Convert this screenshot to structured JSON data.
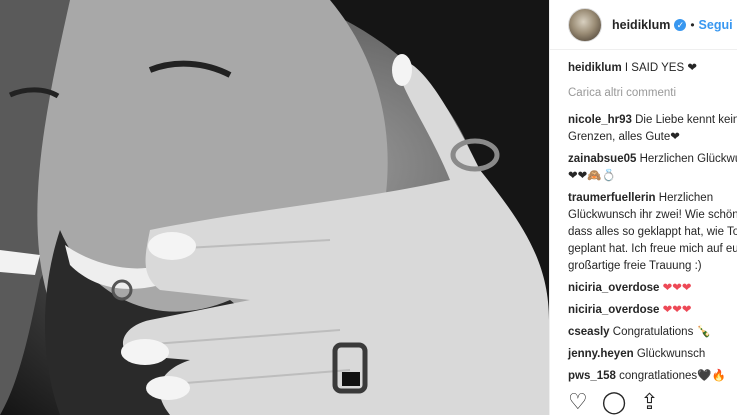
{
  "header": {
    "username": "heidiklum",
    "follow_label": "Segui",
    "verified_glyph": "✓",
    "dot": "•"
  },
  "caption": {
    "user": "heidiklum",
    "text": "I SAID YES ❤"
  },
  "load_more": "Carica altri commenti",
  "comments": [
    {
      "user": "nicole_hr93",
      "text": "Die Liebe kennt keine Grenzen, alles Gute❤"
    },
    {
      "user": "zainabsue05",
      "text": "Herzlichen Glückwunsch ❤❤🙈💍"
    },
    {
      "user": "traumerfuellerin",
      "text": "Herzlichen Glückwunsch ihr zwei! Wie schön, dass alles so geklappt hat, wie Tom es geplant hat. Ich freue mich auf eure großartige freie Trauung :)"
    },
    {
      "user": "niciria_overdose",
      "text": "❤❤❤"
    },
    {
      "user": "niciria_overdose",
      "text": "❤❤❤"
    },
    {
      "user": "cseasly",
      "text": "Congratulations 🍾"
    },
    {
      "user": "jenny.heyen",
      "text": "Glückwunsch"
    },
    {
      "user": "pws_158",
      "text": "congratlationes🖤🔥"
    }
  ],
  "actions": {
    "like_icon": "♡",
    "comment_icon": "◯",
    "share_icon": "⇪"
  },
  "colors": {
    "link_blue": "#3897f0",
    "text": "#262626",
    "muted": "#999999"
  }
}
